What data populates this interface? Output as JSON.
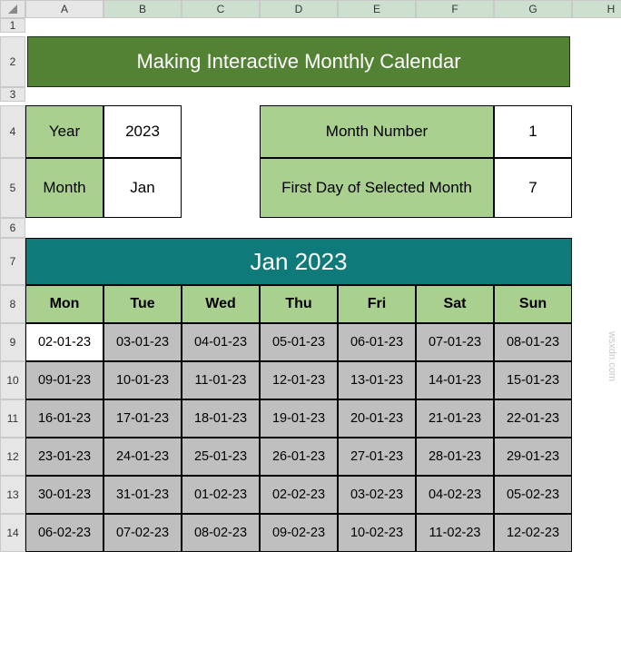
{
  "columns": [
    "A",
    "B",
    "C",
    "D",
    "E",
    "F",
    "G",
    "H",
    ""
  ],
  "row_labels": [
    "1",
    "2",
    "3",
    "4",
    "5",
    "6",
    "7",
    "8",
    "9",
    "10",
    "11",
    "12",
    "13",
    "14"
  ],
  "title": "Making Interactive Monthly Calendar",
  "inputs": {
    "year_label": "Year",
    "year_value": "2023",
    "month_label": "Month",
    "month_value": "Jan",
    "month_number_label": "Month Number",
    "month_number_value": "1",
    "first_day_label": "First Day of Selected Month",
    "first_day_value": "7"
  },
  "calendar": {
    "title": "Jan 2023",
    "days": [
      "Mon",
      "Tue",
      "Wed",
      "Thu",
      "Fri",
      "Sat",
      "Sun"
    ],
    "weeks": [
      [
        "02-01-23",
        "03-01-23",
        "04-01-23",
        "05-01-23",
        "06-01-23",
        "07-01-23",
        "08-01-23"
      ],
      [
        "09-01-23",
        "10-01-23",
        "11-01-23",
        "12-01-23",
        "13-01-23",
        "14-01-23",
        "15-01-23"
      ],
      [
        "16-01-23",
        "17-01-23",
        "18-01-23",
        "19-01-23",
        "20-01-23",
        "21-01-23",
        "22-01-23"
      ],
      [
        "23-01-23",
        "24-01-23",
        "25-01-23",
        "26-01-23",
        "27-01-23",
        "28-01-23",
        "29-01-23"
      ],
      [
        "30-01-23",
        "31-01-23",
        "01-02-23",
        "02-02-23",
        "03-02-23",
        "04-02-23",
        "05-02-23"
      ],
      [
        "06-02-23",
        "07-02-23",
        "08-02-23",
        "09-02-23",
        "10-02-23",
        "11-02-23",
        "12-02-23"
      ]
    ],
    "selected": [
      0,
      0
    ]
  },
  "watermark": "wsxdn.com"
}
